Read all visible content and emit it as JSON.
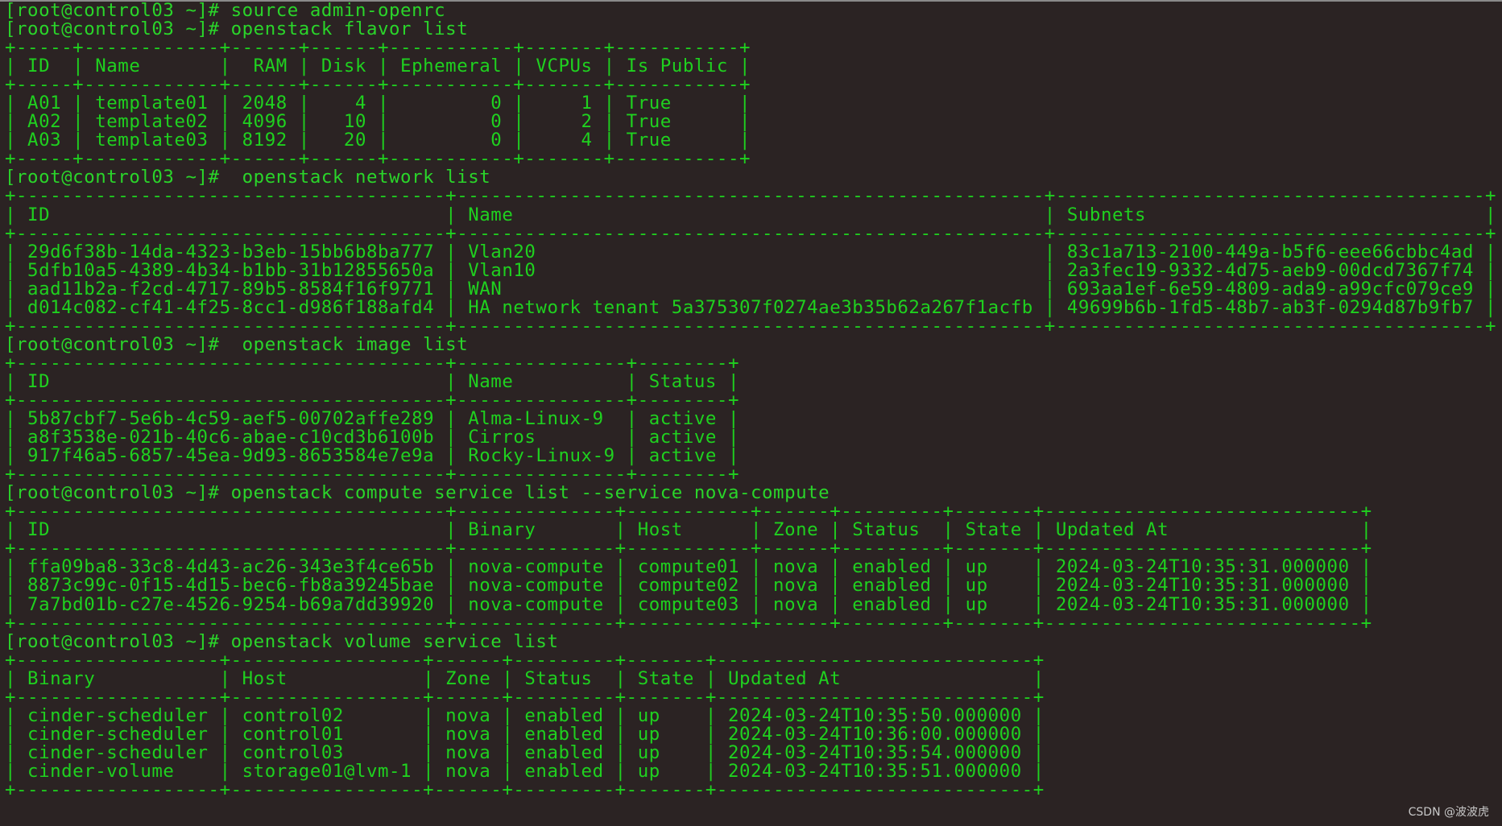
{
  "terminal": {
    "lines": [
      "[root@control03 ~]# source admin-openrc",
      "[root@control03 ~]# openstack flavor list",
      "+-----+------------+------+------+-----------+-------+-----------+",
      "| ID  | Name       |  RAM | Disk | Ephemeral | VCPUs | Is Public |",
      "+-----+------------+------+------+-----------+-------+-----------+",
      "| A01 | template01 | 2048 |    4 |         0 |     1 | True      |",
      "| A02 | template02 | 4096 |   10 |         0 |     2 | True      |",
      "| A03 | template03 | 8192 |   20 |         0 |     4 | True      |",
      "+-----+------------+------+------+-----------+-------+-----------+",
      "[root@control03 ~]#  openstack network list",
      "+--------------------------------------+----------------------------------------------------+--------------------------------------+",
      "| ID                                   | Name                                               | Subnets                              |",
      "+--------------------------------------+----------------------------------------------------+--------------------------------------+",
      "| 29d6f38b-14da-4323-b3eb-15bb6b8ba777 | Vlan20                                             | 83c1a713-2100-449a-b5f6-eee66cbbc4ad |",
      "| 5dfb10a5-4389-4b34-b1bb-31b12855650a | Vlan10                                             | 2a3fec19-9332-4d75-aeb9-00dcd7367f74 |",
      "| aad11b2a-f2cd-4717-89b5-8584f16f9771 | WAN                                                | 693aa1ef-6e59-4809-ada9-a99cfc079ce9 |",
      "| d014c082-cf41-4f25-8cc1-d986f188afd4 | HA network tenant 5a375307f0274ae3b35b62a267f1acfb | 49699b6b-1fd5-48b7-ab3f-0294d87b9fb7 |",
      "+--------------------------------------+----------------------------------------------------+--------------------------------------+",
      "[root@control03 ~]#  openstack image list",
      "+--------------------------------------+---------------+--------+",
      "| ID                                   | Name          | Status |",
      "+--------------------------------------+---------------+--------+",
      "| 5b87cbf7-5e6b-4c59-aef5-00702affe289 | Alma-Linux-9  | active |",
      "| a8f3538e-021b-40c6-abae-c10cd3b6100b | Cirros        | active |",
      "| 917f46a5-6857-45ea-9d93-8653584e7e9a | Rocky-Linux-9 | active |",
      "+--------------------------------------+---------------+--------+",
      "[root@control03 ~]# openstack compute service list --service nova-compute",
      "+--------------------------------------+--------------+-----------+------+---------+-------+----------------------------+",
      "| ID                                   | Binary       | Host      | Zone | Status  | State | Updated At                 |",
      "+--------------------------------------+--------------+-----------+------+---------+-------+----------------------------+",
      "| ffa09ba8-33c8-4d43-ac26-343e3f4ce65b | nova-compute | compute01 | nova | enabled | up    | 2024-03-24T10:35:31.000000 |",
      "| 8873c99c-0f15-4d15-bec6-fb8a39245bae | nova-compute | compute02 | nova | enabled | up    | 2024-03-24T10:35:31.000000 |",
      "| 7a7bd01b-c27e-4526-9254-b69a7dd39920 | nova-compute | compute03 | nova | enabled | up    | 2024-03-24T10:35:31.000000 |",
      "+--------------------------------------+--------------+-----------+------+---------+-------+----------------------------+",
      "[root@control03 ~]# openstack volume service list",
      "+------------------+-----------------+------+---------+-------+----------------------------+",
      "| Binary           | Host            | Zone | Status  | State | Updated At                 |",
      "+------------------+-----------------+------+---------+-------+----------------------------+",
      "| cinder-scheduler | control02       | nova | enabled | up    | 2024-03-24T10:35:50.000000 |",
      "| cinder-scheduler | control01       | nova | enabled | up    | 2024-03-24T10:36:00.000000 |",
      "| cinder-scheduler | control03       | nova | enabled | up    | 2024-03-24T10:35:54.000000 |",
      "| cinder-volume    | storage01@lvm-1 | nova | enabled | up    | 2024-03-24T10:35:51.000000 |",
      "+------------------+-----------------+------+---------+-------+----------------------------+"
    ]
  },
  "watermark": "CSDN @波波虎",
  "colors": {
    "background": "#2b2323",
    "text": "#1fd11f",
    "watermark": "#c8c8c8"
  }
}
